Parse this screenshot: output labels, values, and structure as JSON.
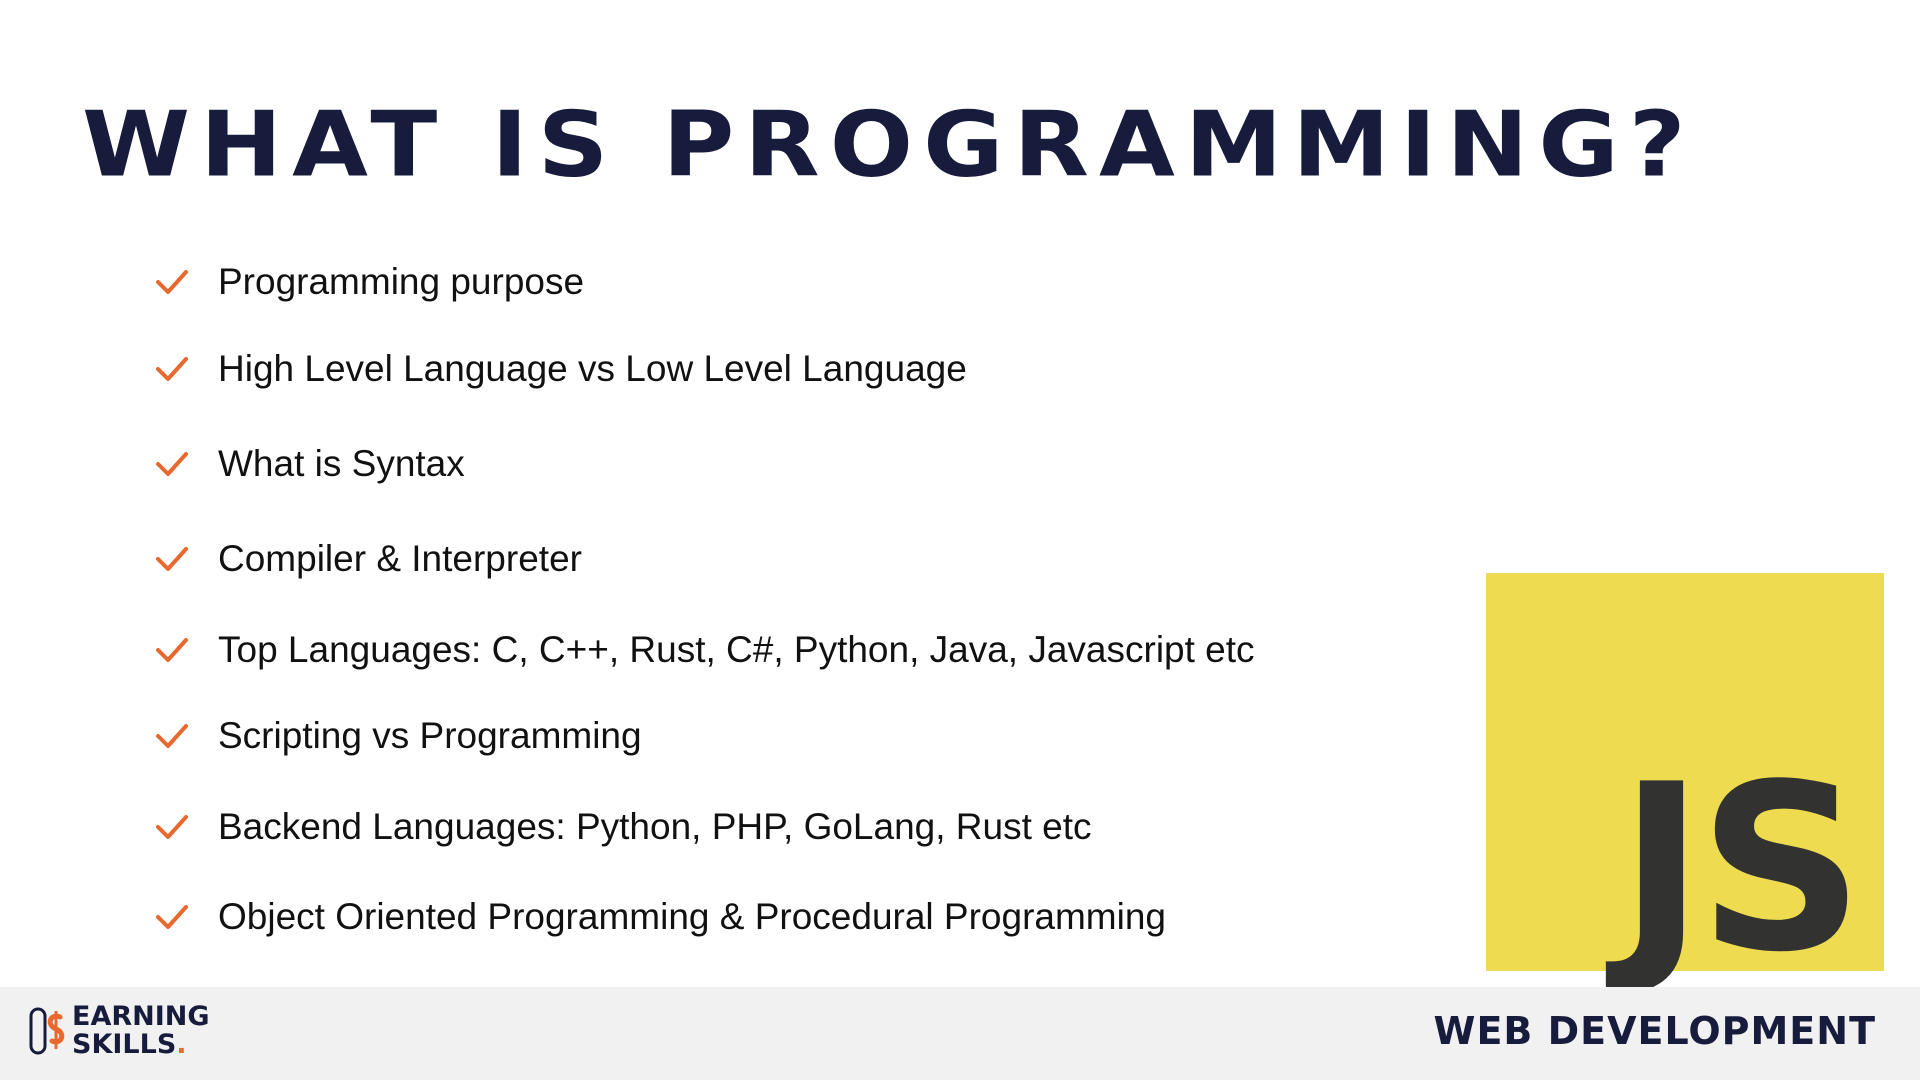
{
  "title": "WHAT IS PROGRAMMING?",
  "bullets": [
    "Programming purpose",
    "High Level Language vs Low Level Language",
    "What is Syntax",
    "Compiler & Interpreter",
    "Top Languages: C, C++, Rust, C#, Python, Java, Javascript etc",
    "Scripting vs Programming",
    "Backend Languages: Python, PHP, GoLang, Rust etc",
    "Object Oriented Programming & Procedural Programming"
  ],
  "bullet_icon": "check-icon",
  "js_logo": {
    "text": "JS",
    "bg_color": "#efdb4f",
    "text_color": "#323330"
  },
  "footer": {
    "brand_line1": "EARNING",
    "brand_line2": "SKILLS",
    "brand_dot": ".",
    "label": "WEB DEVELOPMENT"
  },
  "colors": {
    "title": "#171c3c",
    "check": "#e8692e",
    "footer_bg": "#f1f1f1"
  }
}
